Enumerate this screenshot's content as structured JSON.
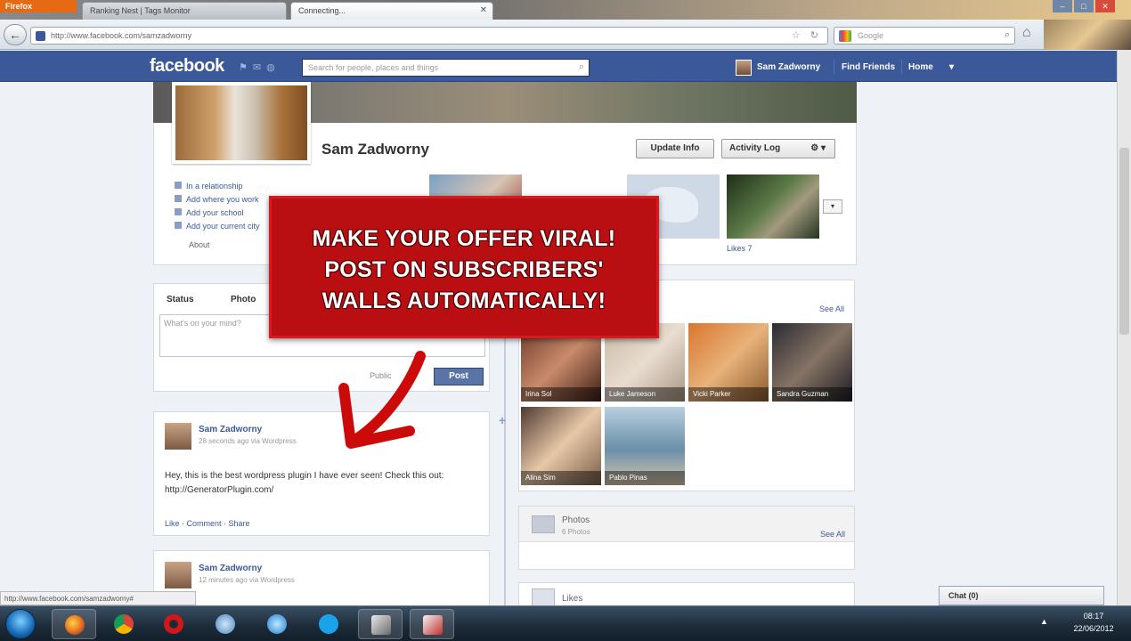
{
  "browser": {
    "menu_label": "Firefox",
    "tabs": [
      {
        "title": "Ranking Nest | Tags Monitor",
        "active": false
      },
      {
        "title": "Connecting...",
        "active": true
      }
    ],
    "url": "http://www.facebook.com/samzadworny",
    "search_placeholder": "Google"
  },
  "fb": {
    "logo": "facebook",
    "search_placeholder": "Search for people, places and things",
    "user_name": "Sam Zadworny",
    "nav": [
      "Find Friends",
      "Home"
    ],
    "brand_color": "#3b5998"
  },
  "profile": {
    "name": "Sam Zadworny",
    "update_info": "Update Info",
    "activity_log": "Activity Log",
    "about": [
      "In a relationship",
      "Add where you work",
      "Add your school",
      "Add your current city"
    ],
    "about_label": "About",
    "apps_caption": "Likes 7"
  },
  "composer": {
    "status_tab": "Status",
    "photo_tab": "Photo",
    "placeholder": "What's on your mind?",
    "meta": "Public",
    "post_button": "Post"
  },
  "stories": [
    {
      "author": "Sam Zadworny",
      "time": "28 seconds ago via Wordpress",
      "body": "Hey, this is the best wordpress plugin I have ever seen! Check this out: http://GeneratorPlugin.com/",
      "actions": "Like · Comment · Share"
    },
    {
      "author": "Sam Zadworny",
      "time": "12 minutes ago via Wordpress",
      "body": "",
      "actions": ""
    }
  ],
  "friends": {
    "see_all": "See All",
    "items": [
      {
        "name": "Irina Sol"
      },
      {
        "name": "Luke Jameson"
      },
      {
        "name": "Vicki Parker"
      },
      {
        "name": "Sandra Guzman"
      },
      {
        "name": "Alina Sim"
      },
      {
        "name": "Pablo Pinas"
      }
    ]
  },
  "photos": {
    "title": "Photos",
    "count": "6 Photos",
    "see_all": "See All"
  },
  "likes": {
    "title": "Likes"
  },
  "status_url": "http://www.facebook.com/samzadworny#",
  "chat": {
    "label": "Chat (0)"
  },
  "overlay": {
    "lines": [
      "MAKE YOUR OFFER VIRAL!",
      "POST ON SUBSCRIBERS'",
      "WALLS AUTOMATICALLY!"
    ],
    "color": "#b90e12",
    "arrow_color": "#cc0a0a"
  },
  "taskbar": {
    "time": "08:17",
    "date": "22/06/2012"
  }
}
